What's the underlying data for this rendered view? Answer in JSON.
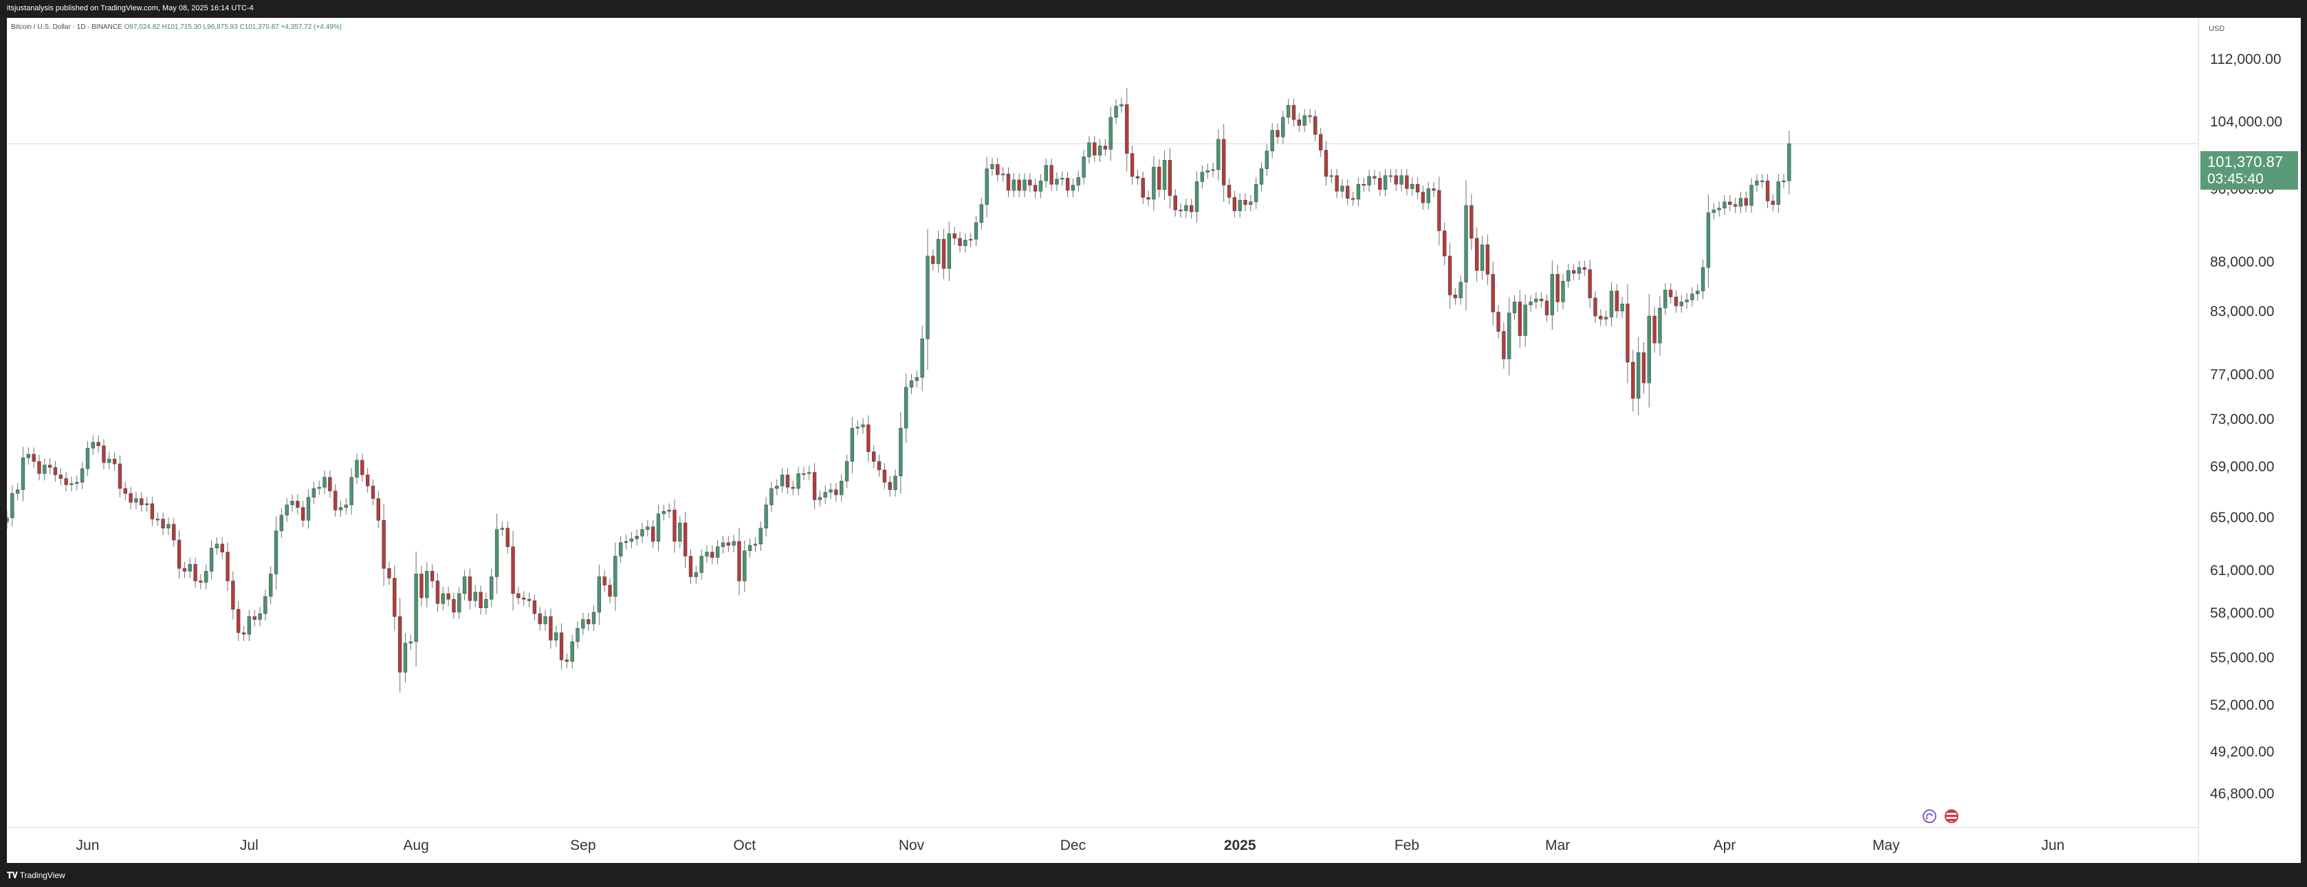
{
  "header": {
    "publish_text": "itsjustanalysis published on TradingView.com, May 08, 2025 16:14 UTC-4"
  },
  "legend": {
    "symbol": "Bitcoin / U.S. Dollar · 1D · BINANCE",
    "open": "O97,024.82",
    "high": "H101,715.30",
    "low": "L96,875.93",
    "close": "C101,370.87",
    "change": "+4,357.72 (+4.49%)"
  },
  "price_axis": {
    "unit": "USD",
    "current_price": "101,370.87",
    "countdown": "03:45:40"
  },
  "footer": {
    "brand": "TradingView"
  },
  "colors": {
    "up": "#4a9470",
    "down": "#b33c3c",
    "price_tag": "#5a9a78",
    "background": "#ffffff",
    "frame": "#1e1e1e"
  },
  "icons": [
    "event-icon",
    "us-flag-icon"
  ],
  "chart_data": {
    "type": "candlestick",
    "scale": "log",
    "interval": "1D",
    "ylim": [
      45000,
      120000
    ],
    "y_ticks": [
      112000,
      104000,
      96000,
      88000,
      83000,
      77000,
      73000,
      69000,
      65000,
      61000,
      58000,
      55000,
      52000,
      49200,
      46800
    ],
    "y_tick_labels": [
      "112,000.00",
      "104,000.00",
      "96,000.00",
      "88,000.00",
      "83,000.00",
      "77,000.00",
      "73,000.00",
      "69,000.00",
      "65,000.00",
      "61,000.00",
      "58,000.00",
      "55,000.00",
      "52,000.00",
      "49,200.00",
      "46,800.00"
    ],
    "x_range": [
      "2024-05-17",
      "2025-06-28"
    ],
    "x_ticks": [
      {
        "date": "2024-06-01",
        "label": "Jun",
        "bold": false
      },
      {
        "date": "2024-07-01",
        "label": "Jul",
        "bold": false
      },
      {
        "date": "2024-08-01",
        "label": "Aug",
        "bold": false
      },
      {
        "date": "2024-09-01",
        "label": "Sep",
        "bold": false
      },
      {
        "date": "2024-10-01",
        "label": "Oct",
        "bold": false
      },
      {
        "date": "2024-11-01",
        "label": "Nov",
        "bold": false
      },
      {
        "date": "2024-12-01",
        "label": "Dec",
        "bold": false
      },
      {
        "date": "2025-01-01",
        "label": "2025",
        "bold": true
      },
      {
        "date": "2025-02-01",
        "label": "Feb",
        "bold": false
      },
      {
        "date": "2025-03-01",
        "label": "Mar",
        "bold": false
      },
      {
        "date": "2025-04-01",
        "label": "Apr",
        "bold": false
      },
      {
        "date": "2025-05-01",
        "label": "May",
        "bold": false
      },
      {
        "date": "2025-06-01",
        "label": "Jun",
        "bold": false
      }
    ],
    "start_date": "2024-05-17",
    "current_price_line": 101370.87,
    "closes": [
      65000,
      66900,
      67200,
      69800,
      70100,
      69500,
      68500,
      69200,
      69000,
      68400,
      68100,
      67600,
      67700,
      67800,
      68900,
      70600,
      71100,
      70800,
      69400,
      69700,
      69300,
      67300,
      66900,
      66200,
      66500,
      66000,
      66100,
      64900,
      64900,
      64200,
      64500,
      63300,
      61200,
      61000,
      61500,
      60300,
      60200,
      61000,
      62700,
      63000,
      62400,
      60300,
      58300,
      56700,
      56600,
      57800,
      57600,
      58000,
      59200,
      60800,
      64000,
      65200,
      66000,
      66300,
      65800,
      64800,
      66600,
      67300,
      67400,
      68200,
      67100,
      65600,
      65800,
      66000,
      68200,
      69600,
      68400,
      67500,
      66500,
      64800,
      61200,
      60500,
      57800,
      54100,
      56000,
      56100,
      60800,
      59100,
      61000,
      60300,
      58700,
      59400,
      59000,
      58100,
      59400,
      60600,
      58900,
      59500,
      58400,
      59000,
      60600,
      64100,
      64200,
      62800,
      59400,
      59100,
      59000,
      58900,
      58000,
      57300,
      57800,
      56200,
      56700,
      54900,
      54800,
      56100,
      57000,
      57600,
      57300,
      58100,
      60600,
      60000,
      59200,
      62100,
      63100,
      63200,
      63400,
      63600,
      64100,
      64300,
      63200,
      65300,
      65500,
      65600,
      63200,
      64600,
      62100,
      60600,
      60900,
      62100,
      62400,
      62000,
      62800,
      63100,
      62900,
      63200,
      60300,
      62500,
      62900,
      63000,
      64200,
      66000,
      67300,
      67500,
      68400,
      67400,
      67300,
      68500,
      68500,
      68600,
      66400,
      66600,
      67000,
      67200,
      66800,
      67900,
      69500,
      72300,
      72400,
      72600,
      70300,
      69500,
      68800,
      67800,
      67200,
      68300,
      72300,
      75900,
      76500,
      76800,
      80400,
      88700,
      87900,
      90500,
      87400,
      91100,
      90600,
      89800,
      90400,
      90500,
      92300,
      94300,
      98400,
      98900,
      97700,
      97800,
      95900,
      97100,
      95900,
      97100,
      96500,
      95800,
      97000,
      98800,
      96600,
      97200,
      97300,
      95900,
      96500,
      97400,
      99800,
      101500,
      100000,
      101100,
      100700,
      104600,
      106000,
      106200,
      100200,
      97500,
      97300,
      95100,
      94900,
      98600,
      96000,
      99400,
      95300,
      93700,
      93600,
      94200,
      93500,
      96900,
      98000,
      98200,
      98300,
      101900,
      96500,
      95100,
      93600,
      94800,
      94300,
      94600,
      96600,
      98400,
      100500,
      103000,
      102200,
      104600,
      106100,
      104300,
      103600,
      104800,
      104700,
      102500,
      100600,
      97500,
      97600,
      95800,
      96400,
      95000,
      94900,
      96600,
      96500,
      97500,
      97300,
      96000,
      97600,
      97600,
      96600,
      97600,
      96100,
      96600,
      95700,
      94500,
      96100,
      95900,
      91400,
      88700,
      84700,
      84400,
      86000,
      94200,
      90600,
      87200,
      89900,
      86800,
      83000,
      81100,
      78500,
      82900,
      84000,
      80700,
      83700,
      84000,
      84300,
      84100,
      82700,
      86800,
      84000,
      86100,
      87200,
      86900,
      87500,
      87300,
      84400,
      82600,
      82300,
      82500,
      85100,
      83100,
      83800,
      78200,
      74900,
      79100,
      76300,
      82600,
      80000,
      83400,
      85200,
      84500,
      83600,
      84000,
      84200,
      84800,
      85100,
      87500,
      93400,
      93700,
      93900,
      94600,
      94300,
      94100,
      95000,
      94200,
      96500,
      97000,
      97000,
      94700,
      94300,
      96900,
      97000,
      101370.87
    ]
  }
}
